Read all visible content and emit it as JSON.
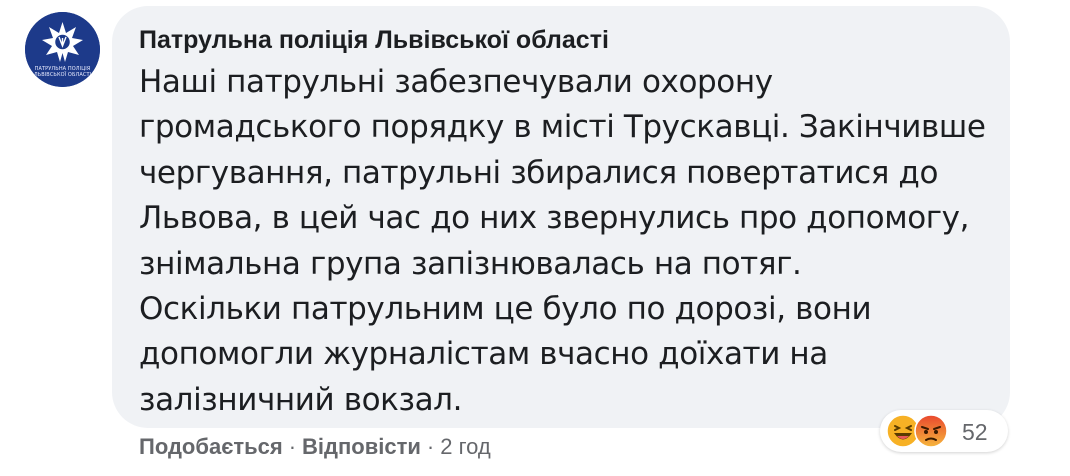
{
  "comment": {
    "author": "Патрульна поліція Львівської області",
    "avatar_text": "ПАТРУЛЬНА ПОЛІЦІЯ ЛЬВІВСЬКОЇ ОБЛАСТІ",
    "avatar_icon": "police-star-emblem-icon",
    "text_lines": [
      "Наші патрульні забезпечували охорону",
      "громадського порядку в місті Трускавці. Закінчивше",
      "чергування, патрульні збиралися повертатися до",
      "Львова, в цей час до них звернулись про допомогу,",
      "знімальна група запізнювалась на потяг.",
      "Оскільки патрульним це було по дорозі, вони",
      "допомогли журналістам вчасно доїхати на",
      "залізничний вокзал."
    ]
  },
  "actions": {
    "like_label": "Подобається",
    "reply_label": "Відповісти",
    "separator": "·",
    "time": "2 год"
  },
  "reactions": {
    "icons": [
      "haha-reaction-icon",
      "angry-reaction-icon"
    ],
    "count": "52"
  },
  "colors": {
    "bubble": "#f0f2f5",
    "text": "#1c1e21",
    "meta": "#65676b",
    "avatar": "#1d3a8a"
  }
}
